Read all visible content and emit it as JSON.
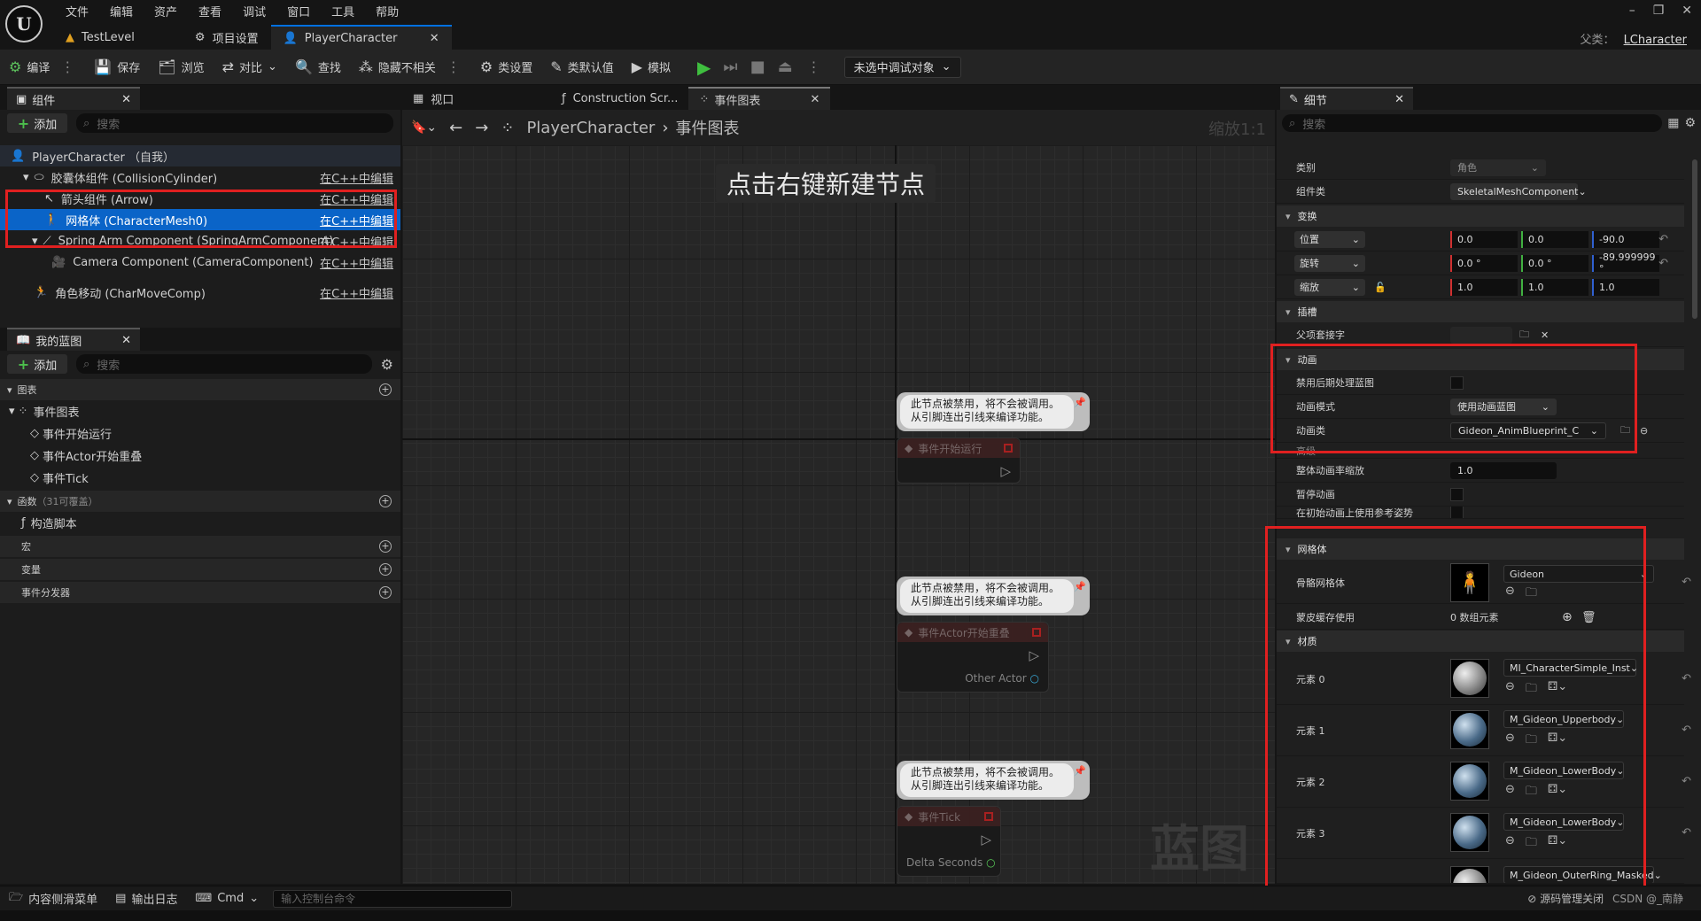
{
  "menu": [
    "文件",
    "编辑",
    "资产",
    "查看",
    "调试",
    "窗口",
    "工具",
    "帮助"
  ],
  "tabs": {
    "level": "TestLevel",
    "project_settings": "项目设置",
    "player": "PlayerCharacter"
  },
  "parent_class": {
    "label": "父类：",
    "value": "LCharacter"
  },
  "toolbar": {
    "compile": "编译",
    "save": "保存",
    "browse": "浏览",
    "diff": "对比",
    "find": "查找",
    "hide_unrelated": "隐藏不相关",
    "class_settings": "类设置",
    "class_defaults": "类默认值",
    "simulate": "模拟",
    "debug_target": "未选中调试对象"
  },
  "components": {
    "tab": "组件",
    "add": "添加",
    "search_placeholder": "搜索",
    "items": [
      {
        "label": "PlayerCharacter （自我）",
        "link": ""
      },
      {
        "label": "胶囊体组件 (CollisionCylinder)",
        "link": "在C++中编辑"
      },
      {
        "label": "箭头组件 (Arrow)",
        "link": "在C++中编辑"
      },
      {
        "label": "网格体 (CharacterMesh0)",
        "link": "在C++中编辑"
      },
      {
        "label": "Spring Arm Component (SpringArmComponent)",
        "link": "在C++中编辑"
      },
      {
        "label": "Camera Component (CameraComponent)",
        "link": "在C++中编辑"
      },
      {
        "label": "角色移动 (CharMoveComp)",
        "link": "在C++中编辑"
      }
    ]
  },
  "my_blueprint": {
    "tab": "我的蓝图",
    "add": "添加",
    "search_placeholder": "搜索",
    "graphs": "图表",
    "event_graph": "事件图表",
    "events": [
      "事件开始运行",
      "事件Actor开始重叠",
      "事件Tick"
    ],
    "functions": "函数",
    "functions_count": "（31可覆盖）",
    "construction_script": "构造脚本",
    "macros": "宏",
    "variables": "变量",
    "dispatchers": "事件分发器"
  },
  "graph": {
    "tabs": [
      "视口",
      "Construction Scr...",
      "事件图表"
    ],
    "breadcrumb_root": "PlayerCharacter",
    "breadcrumb_leaf": "事件图表",
    "zoom": "缩放1:1",
    "hint": "点击右键新建节点",
    "watermark": "蓝图",
    "comment_text_1": "此节点被禁用，将不会被调用。",
    "comment_text_2": "从引脚连出引线来编译功能。",
    "nodes": [
      {
        "title": "事件开始运行",
        "pin": ""
      },
      {
        "title": "事件Actor开始重叠",
        "pin": "Other Actor"
      },
      {
        "title": "事件Tick",
        "pin": "Delta Seconds"
      }
    ]
  },
  "details": {
    "tab": "细节",
    "search_placeholder": "搜索",
    "category_label": "类别",
    "category_value": "角色",
    "component_class_label": "组件类",
    "component_class_value": "SkeletalMeshComponent",
    "transform": "变换",
    "location": "位置",
    "loc": [
      "0.0",
      "0.0",
      "-90.0"
    ],
    "rotation": "旋转",
    "rot": [
      "0.0 °",
      "0.0 °",
      "-89.999999 °"
    ],
    "scale": "缩放",
    "scl": [
      "1.0",
      "1.0",
      "1.0"
    ],
    "sockets": "插槽",
    "parent_socket": "父项套接字",
    "animation": "动画",
    "disable_post_process": "禁用后期处理蓝图",
    "anim_mode_label": "动画模式",
    "anim_mode_value": "使用动画蓝图",
    "anim_class_label": "动画类",
    "anim_class_value": "Gideon_AnimBlueprint_C",
    "advanced": "高级",
    "global_rate": "整体动画率缩放",
    "global_rate_value": "1.0",
    "pause_anims": "暂停动画",
    "ref_pose": "在初始动画上使用参考姿势",
    "mesh": "网格体",
    "skeletal_mesh": "骨骼网格体",
    "skeletal_mesh_value": "Gideon",
    "skin_cache": "蒙皮缓存使用",
    "skin_cache_value": "0 数组元素",
    "materials": "材质",
    "elements": [
      {
        "label": "元素 0",
        "value": "MI_CharacterSimple_Inst"
      },
      {
        "label": "元素 1",
        "value": "M_Gideon_Upperbody"
      },
      {
        "label": "元素 2",
        "value": "M_Gideon_LowerBody"
      },
      {
        "label": "元素 3",
        "value": "M_Gideon_LowerBody"
      },
      {
        "label": "",
        "value": "M_Gideon_OuterRing_Masked"
      }
    ]
  },
  "bottom": {
    "content_drawer": "内容侧滑菜单",
    "output_log": "输出日志",
    "cmd": "Cmd",
    "cmd_placeholder": "输入控制台命令",
    "status": "源码管理关闭",
    "credit": "CSDN @_南静"
  }
}
